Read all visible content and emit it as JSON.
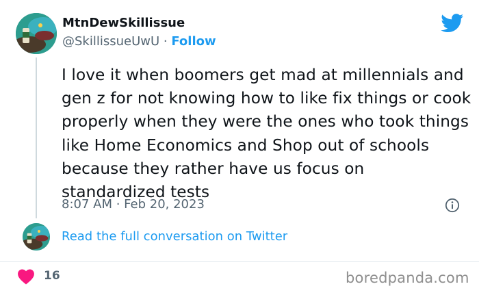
{
  "author": {
    "display_name": "MtnDewSkillissue",
    "handle": "@SkillissueUwU",
    "separator": " · ",
    "follow_label": "Follow"
  },
  "tweet": {
    "text": "I love it when boomers get mad at millennials and gen z for not knowing how to like fix things or cook properly when they were the ones who took things like Home Economics and Shop out of schools because they rather have us focus on standardized tests",
    "timestamp": "8:07 AM · Feb 20, 2023"
  },
  "conversation_link": "Read the full conversation on Twitter",
  "likes": {
    "count": "16"
  },
  "watermark": "boredpanda.com",
  "icons": {
    "brand": "twitter-bird-icon",
    "info": "info-icon",
    "like": "heart-icon"
  },
  "colors": {
    "accent": "#1d9bf0",
    "heart": "#f91880",
    "secondary_text": "#536471"
  }
}
